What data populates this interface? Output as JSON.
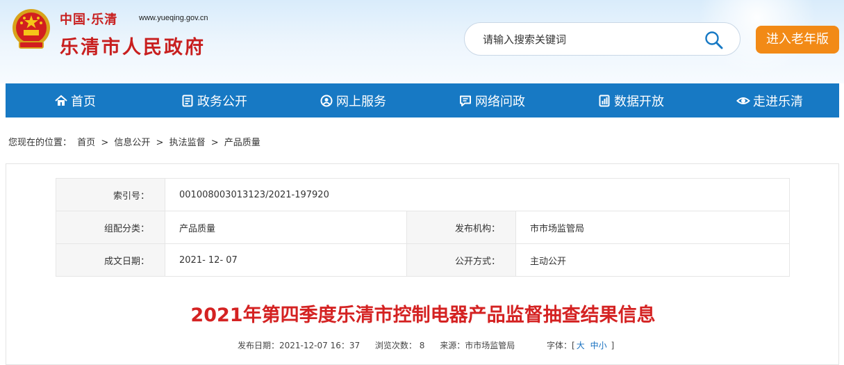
{
  "header": {
    "site_cn": "中国·乐清",
    "site_url": "www.yueqing.gov.cn",
    "site_name": "乐清市人民政府",
    "search_placeholder": "请输入搜索关键词",
    "elder_button": "进入老年版",
    "colors": {
      "brand_red": "#c81f1f",
      "nav_blue": "#1779c4",
      "elder_orange": "#f28a16"
    }
  },
  "nav": {
    "items": [
      {
        "label": "首页",
        "icon": "home-icon"
      },
      {
        "label": "政务公开",
        "icon": "document-icon"
      },
      {
        "label": "网上服务",
        "icon": "service-icon"
      },
      {
        "label": "网络问政",
        "icon": "chat-icon"
      },
      {
        "label": "数据开放",
        "icon": "data-icon"
      },
      {
        "label": "走进乐清",
        "icon": "eye-icon"
      }
    ]
  },
  "breadcrumb": {
    "prefix": "您现在的位置：",
    "items": [
      "首页",
      "信息公开",
      "执法监督",
      "产品质量"
    ],
    "sep": ">"
  },
  "meta": {
    "index_label": "索引号：",
    "index_value": "001008003013123/2021-197920",
    "category_label": "组配分类：",
    "category_value": "产品质量",
    "publisher_label": "发布机构：",
    "publisher_value": "市市场监管局",
    "date_label": "成文日期：",
    "date_value": "2021- 12- 07",
    "mode_label": "公开方式：",
    "mode_value": "主动公开"
  },
  "article": {
    "title": "2021年第四季度乐清市控制电器产品监督抽查结果信息",
    "publish_date": "发布日期：2021-12-07 16：37",
    "views": "浏览次数：  8",
    "source": "来源：市市场监管局",
    "font_label": "字体：[",
    "font_large": "大",
    "font_medium": "中",
    "font_small": "小",
    "font_end": "]"
  }
}
